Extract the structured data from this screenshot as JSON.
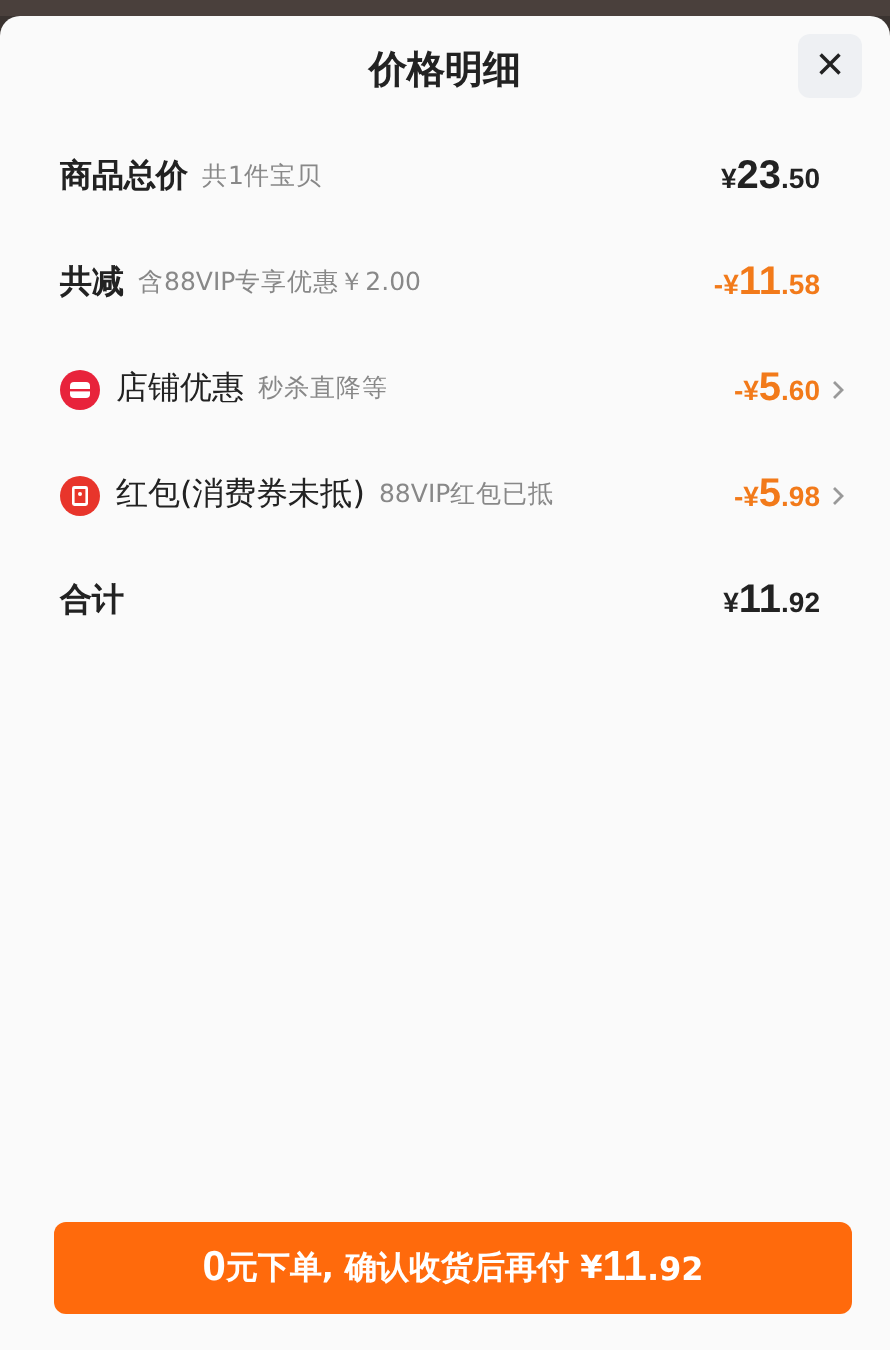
{
  "sheet": {
    "title": "价格明细",
    "close": "×"
  },
  "rows": [
    {
      "kind": "plain",
      "label": "商品总价",
      "note": "共1件宝贝",
      "bold": true,
      "highlighted": false,
      "has_detail": false,
      "amount": {
        "prefix": "¥",
        "whole": "23",
        "fraction": ".50"
      }
    },
    {
      "kind": "plain",
      "label": "共减",
      "note": "含88VIP专享优惠￥2.00",
      "bold": true,
      "highlighted": true,
      "has_detail": false,
      "amount": {
        "prefix": "-¥",
        "whole": "11",
        "fraction": ".58"
      }
    },
    {
      "kind": "shop",
      "label": "店铺优惠",
      "note": "秒杀直降等",
      "bold": false,
      "highlighted": true,
      "has_detail": true,
      "amount": {
        "prefix": "-¥",
        "whole": "5",
        "fraction": ".60"
      }
    },
    {
      "kind": "envelope",
      "label": "红包(消费券未抵)",
      "note": "88VIP红包已抵",
      "bold": false,
      "highlighted": true,
      "has_detail": true,
      "amount": {
        "prefix": "-¥",
        "whole": "5",
        "fraction": ".98"
      }
    },
    {
      "kind": "plain",
      "label": "合计",
      "note": "",
      "bold": true,
      "highlighted": false,
      "has_detail": false,
      "amount": {
        "prefix": "¥",
        "whole": "11",
        "fraction": ".92"
      }
    }
  ],
  "button": {
    "parts": [
      {
        "text": "0",
        "big": true
      },
      {
        "text": "元下单, 确认收货后再付 ¥",
        "big": false
      },
      {
        "text": "11",
        "big": true
      },
      {
        "text": ".92",
        "big": false
      }
    ]
  }
}
